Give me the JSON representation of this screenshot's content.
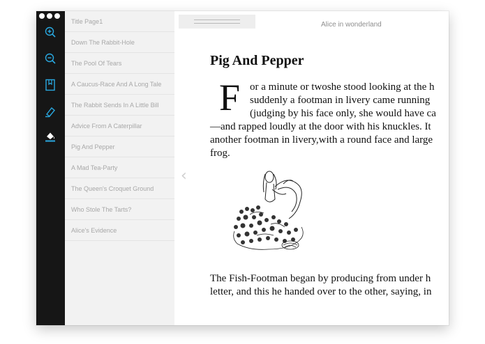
{
  "toolbar": {
    "icons": [
      "zoom-in-icon",
      "zoom-out-icon",
      "bookmark-icon",
      "highlighter-icon",
      "fill-color-icon"
    ],
    "accent": "#29a8e0"
  },
  "toc": {
    "items": [
      "Title Page1",
      "Down The Rabbit-Hole",
      "The Pool Of Tears",
      "A Caucus-Race And A Long Tale",
      "The Rabbit Sends In A Little Bill",
      "Advice From A Caterpillar",
      "Pig And Pepper",
      "A Mad Tea-Party",
      "The Queen's Croquet Ground",
      "Who Stole The Tarts?",
      "Alice's Evidence"
    ]
  },
  "reader": {
    "book_title": "Alice in wonderland",
    "chapter_title": "Pig And Pepper",
    "drop_cap": "F",
    "para1": [
      "or a minute or twoshe stood looking at the h",
      "suddenly a footman in livery came running",
      "(judging by his face only, she would have ca",
      "—and rapped loudly at the door with his knuckles. It",
      "another footman in livery,with a round face and large",
      "frog."
    ],
    "para2": [
      "The Fish-Footman began by producing from under h",
      "letter, and this he handed over to the other, saying, in"
    ],
    "prev_glyph": "‹"
  }
}
